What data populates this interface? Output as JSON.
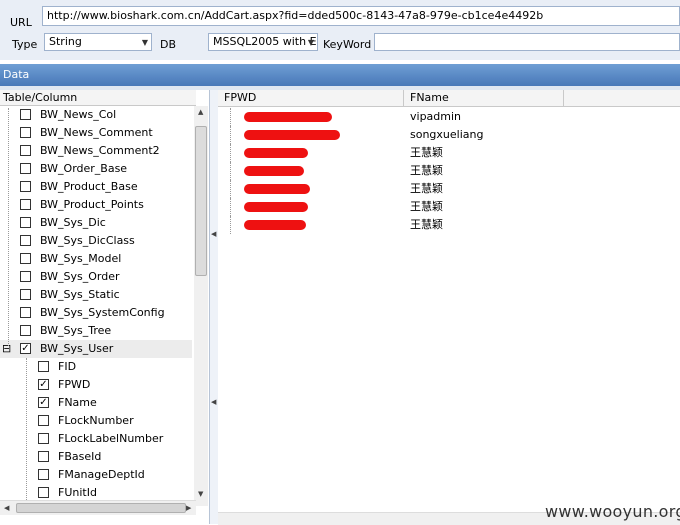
{
  "form": {
    "url_label": "URL",
    "url_value": "http://www.bioshark.com.cn/AddCart.aspx?fid=dded500c-8143-47a8-979e-cb1ce4e4492b",
    "type_label": "Type",
    "type_value": "String",
    "db_label": "DB",
    "db_value": "MSSQL2005 with E",
    "keyword_label": "KeyWord",
    "keyword_value": ""
  },
  "data_title": "Data",
  "tree": {
    "header": "Table/Column",
    "tables": [
      {
        "label": "BW_News_Col",
        "checked": false
      },
      {
        "label": "BW_News_Comment",
        "checked": false
      },
      {
        "label": "BW_News_Comment2",
        "checked": false
      },
      {
        "label": "BW_Order_Base",
        "checked": false
      },
      {
        "label": "BW_Product_Base",
        "checked": false
      },
      {
        "label": "BW_Product_Points",
        "checked": false
      },
      {
        "label": "BW_Sys_Dic",
        "checked": false
      },
      {
        "label": "BW_Sys_DicClass",
        "checked": false
      },
      {
        "label": "BW_Sys_Model",
        "checked": false
      },
      {
        "label": "BW_Sys_Order",
        "checked": false
      },
      {
        "label": "BW_Sys_Static",
        "checked": false
      },
      {
        "label": "BW_Sys_SystemConfig",
        "checked": false
      },
      {
        "label": "BW_Sys_Tree",
        "checked": false
      },
      {
        "label": "BW_Sys_User",
        "checked": true,
        "expanded": true
      }
    ],
    "columns": [
      {
        "label": "FID",
        "checked": false
      },
      {
        "label": "FPWD",
        "checked": true
      },
      {
        "label": "FName",
        "checked": true
      },
      {
        "label": "FLockNumber",
        "checked": false
      },
      {
        "label": "FLockLabelNumber",
        "checked": false
      },
      {
        "label": "FBaseId",
        "checked": false
      },
      {
        "label": "FManageDeptId",
        "checked": false
      },
      {
        "label": "FUnitId",
        "checked": false
      }
    ]
  },
  "grid": {
    "columns": [
      "FPWD",
      "FName"
    ],
    "rows": [
      {
        "fpwd": "",
        "fname": "vipadmin"
      },
      {
        "fpwd": "",
        "fname": "songxueliang"
      },
      {
        "fpwd": "",
        "fname": "王慧颖"
      },
      {
        "fpwd": "",
        "fname": "王慧颖"
      },
      {
        "fpwd": "",
        "fname": "王慧颖"
      },
      {
        "fpwd": "",
        "fname": "王慧颖"
      },
      {
        "fpwd": "",
        "fname": "王慧颖"
      }
    ]
  },
  "watermark": "www.wooyun.org",
  "colors": {
    "data_bar": "#4f80c0",
    "redaction": "#ee1111"
  }
}
